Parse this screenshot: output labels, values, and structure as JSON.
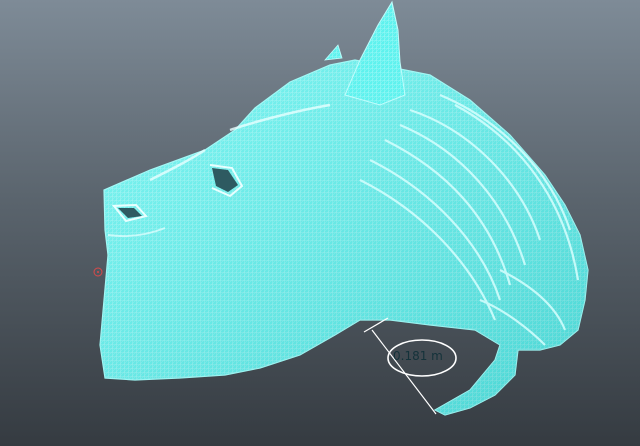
{
  "viewport": {
    "background_top": "#7e8b97",
    "background_bottom": "#353b41",
    "mesh_color": "#5ef2ee",
    "wire_color": "#bffdfc"
  },
  "model": {
    "kind": "wireframe-creature-head",
    "selected": true
  },
  "measurement": {
    "distance_label": "0.181 m"
  },
  "pivot_marker": {
    "icon": "pivot-target-icon"
  }
}
